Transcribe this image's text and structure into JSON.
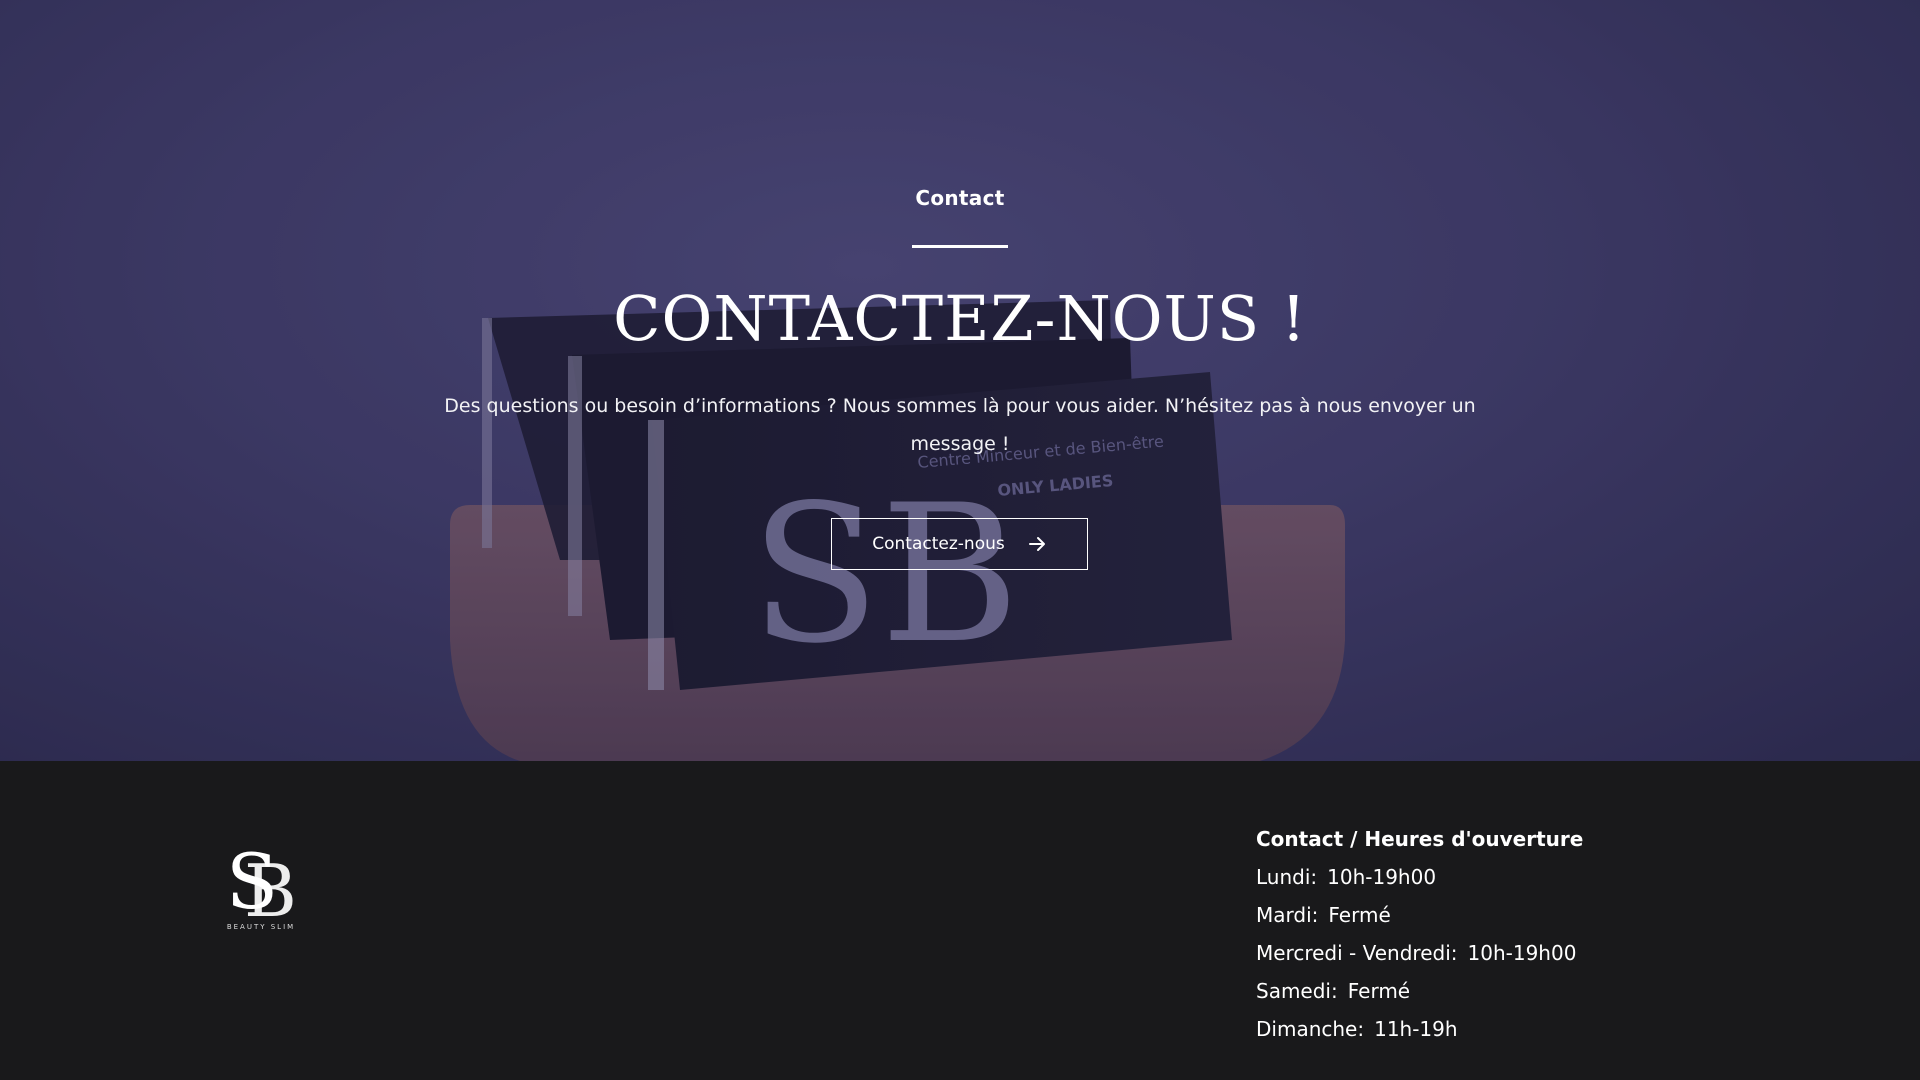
{
  "hero": {
    "eyebrow": "Contact",
    "title": "CONTACTEZ-NOUS !",
    "description": "Des questions ou besoin d’informations ? Nous sommes là pour vous aider. N’hésitez pas à nous envoyer un message !",
    "cta_label": "Contactez-nous",
    "cta_icon": "arrow-right-icon",
    "background_image_text": {
      "line1": "Centre Minceur et de Bien-être",
      "line2": "ONLY LADIES"
    }
  },
  "footer": {
    "logo_text": "BEAUTY SLIM",
    "hours_title": "Contact / Heures d'ouverture",
    "hours": [
      {
        "day": "Lundi:",
        "time": "10h-19h00"
      },
      {
        "day": "Mardi:",
        "time": "Fermé"
      },
      {
        "day": "Mercredi - Vendredi:",
        "time": "10h-19h00"
      },
      {
        "day": "Samedi:",
        "time": "Fermé"
      },
      {
        "day": "Dimanche:",
        "time": "11h-19h"
      }
    ]
  },
  "colors": {
    "hero_purple": "#403d68",
    "footer_bg": "#19191b",
    "text": "#ffffff"
  }
}
